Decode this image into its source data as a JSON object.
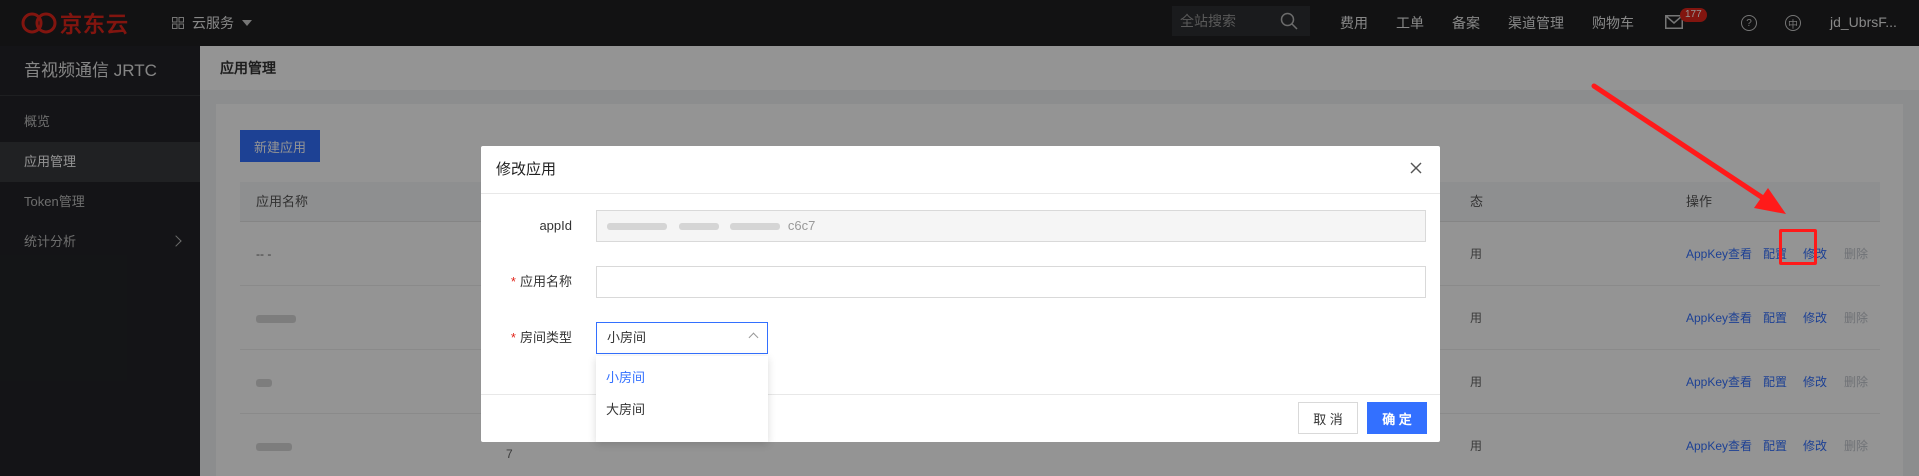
{
  "topbar": {
    "logo_text": "京东云",
    "services_label": "云服务",
    "search_placeholder": "全站搜索",
    "links": [
      "费用",
      "工单",
      "备案",
      "渠道管理",
      "购物车"
    ],
    "mail_badge": "177",
    "user": "jd_UbrsF..."
  },
  "sidebar": {
    "title": "音视频通信 JRTC",
    "items": [
      {
        "label": "概览"
      },
      {
        "label": "应用管理"
      },
      {
        "label": "Token管理"
      },
      {
        "label": "统计分析"
      }
    ]
  },
  "main": {
    "page_title": "应用管理",
    "new_button": "新建应用",
    "columns": {
      "name": "应用名称",
      "status": "态",
      "ops": "操作"
    },
    "rows": [
      {
        "name": "-- -",
        "status": "用",
        "ops": [
          "AppKey查看",
          "配置",
          "修改",
          "删除"
        ]
      },
      {
        "name": "",
        "status": "用",
        "ops": [
          "AppKey查看",
          "配置",
          "修改",
          "删除"
        ]
      },
      {
        "name": "",
        "status": "用",
        "ops": [
          "AppKey查看",
          "配置",
          "修改",
          "删除"
        ]
      },
      {
        "name": "",
        "status": "用",
        "ops": [
          "AppKey查看",
          "配置",
          "修改",
          "删除"
        ],
        "extra": "7"
      }
    ]
  },
  "modal": {
    "title": "修改应用",
    "appid_label": "appId",
    "appid_value": "c6c7",
    "name_label": "应用名称",
    "name_value": "",
    "room_label": "房间类型",
    "room_value": "小房间",
    "options": [
      "小房间",
      "大房间"
    ],
    "cancel": "取 消",
    "ok": "确 定"
  },
  "colors": {
    "accent": "#3370ff",
    "brand": "#e1251b",
    "annotation": "#ff1a1a"
  }
}
